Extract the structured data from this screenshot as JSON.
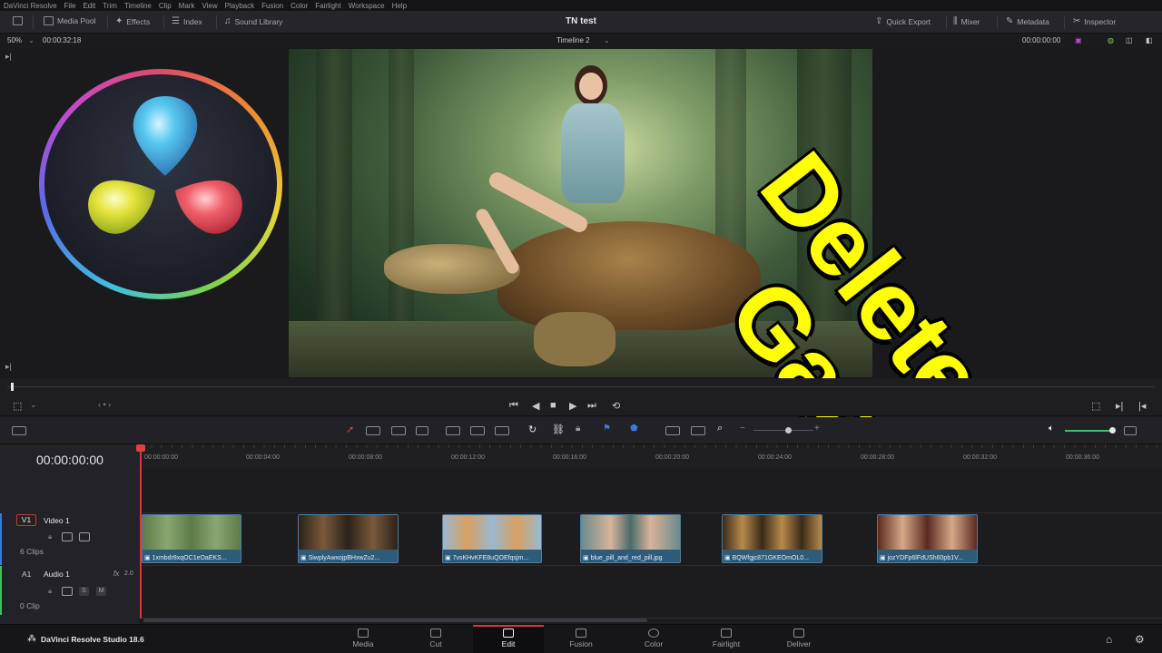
{
  "app": {
    "name": "DaVinci Resolve",
    "version_label": "DaVinci Resolve Studio 18.6"
  },
  "menu": [
    "DaVinci Resolve",
    "File",
    "Edit",
    "Trim",
    "Timeline",
    "Clip",
    "Mark",
    "View",
    "Playback",
    "Fusion",
    "Color",
    "Fairlight",
    "Workspace",
    "Help"
  ],
  "toolbar": {
    "media_pool": "Media Pool",
    "effects": "Effects",
    "index": "Index",
    "sound_library": "Sound Library",
    "project_title": "TN test",
    "quick_export": "Quick Export",
    "mixer": "Mixer",
    "metadata": "Metadata",
    "inspector": "Inspector"
  },
  "viewer": {
    "zoom": "50%",
    "duration": "00:00:32:18",
    "timeline_name": "Timeline 2",
    "timecode": "00:00:00:00"
  },
  "overlay": {
    "line1": "Delete",
    "line2": "Gaps"
  },
  "timeline": {
    "timecode": "00:00:00:00",
    "ruler": [
      "00:00:00:00",
      "00:00:04:00",
      "00:00:08:00",
      "00:00:12:00",
      "00:00:16:00",
      "00:00:20:00",
      "00:00:24:00",
      "00:00:28:00",
      "00:00:32:00",
      "00:00:36:00"
    ],
    "video_track": {
      "id": "V1",
      "name": "Video 1",
      "count": "6 Clips"
    },
    "audio_track": {
      "id": "A1",
      "name": "Audio 1",
      "fx": "fx",
      "channels": "2.0",
      "count": "0 Clip",
      "solo": "S",
      "mute": "M"
    },
    "clips": [
      "1xmbdr8xqOC1eOaEKS...",
      "SiwplyAwxojpBHxwZu2...",
      "7vsKHvKFE8uQOEfqsjm...",
      "blue_pill_and_red_pill.jpg",
      "BQWfgjc871GKEOmOL0...",
      "jozYDFp6lFdUSh60pb1V..."
    ]
  },
  "pages": [
    "Media",
    "Cut",
    "Edit",
    "Fusion",
    "Color",
    "Fairlight",
    "Deliver"
  ],
  "active_page": "Edit",
  "colors": {
    "accent_red": "#e3343a",
    "clip_blue": "#2d5b7a",
    "overlay_yellow": "#ffff00"
  }
}
